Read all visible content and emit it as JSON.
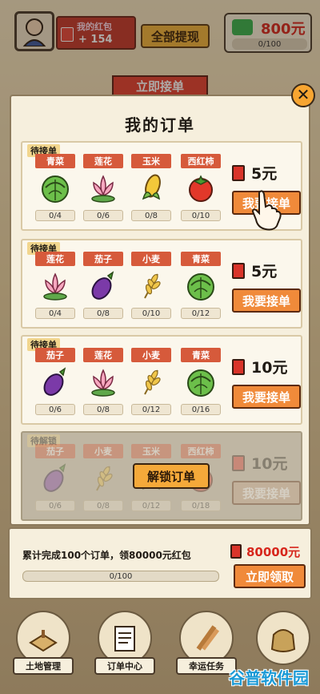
{
  "header": {
    "wallet_label": "我的红包",
    "wallet_value": "+ 154",
    "withdraw_all": "全部提现",
    "cash_amount": "800元",
    "cash_progress": "0/100"
  },
  "background_button": "立即接单",
  "modal": {
    "title": "我的订单",
    "close": "✕",
    "orders": [
      {
        "tag": "待接单",
        "items": [
          {
            "name": "青菜",
            "icon": "cabbage-icon",
            "count": "0/4"
          },
          {
            "name": "莲花",
            "icon": "lotus-icon",
            "count": "0/6"
          },
          {
            "name": "玉米",
            "icon": "corn-icon",
            "count": "0/8"
          },
          {
            "name": "西红柿",
            "icon": "tomato-icon",
            "count": "0/10"
          }
        ],
        "reward": "5元",
        "action": "我要接单"
      },
      {
        "tag": "待接单",
        "items": [
          {
            "name": "莲花",
            "icon": "lotus-icon",
            "count": "0/4"
          },
          {
            "name": "茄子",
            "icon": "eggplant-icon",
            "count": "0/8"
          },
          {
            "name": "小麦",
            "icon": "wheat-icon",
            "count": "0/10"
          },
          {
            "name": "青菜",
            "icon": "cabbage-icon",
            "count": "0/12"
          }
        ],
        "reward": "5元",
        "action": "我要接单"
      },
      {
        "tag": "待接单",
        "items": [
          {
            "name": "茄子",
            "icon": "eggplant-icon",
            "count": "0/6"
          },
          {
            "name": "莲花",
            "icon": "lotus-icon",
            "count": "0/8"
          },
          {
            "name": "小麦",
            "icon": "wheat-icon",
            "count": "0/12"
          },
          {
            "name": "青菜",
            "icon": "cabbage-icon",
            "count": "0/16"
          }
        ],
        "reward": "10元",
        "action": "我要接单"
      },
      {
        "tag": "待解锁",
        "items": [
          {
            "name": "茄子",
            "icon": "eggplant-icon",
            "count": "0/6"
          },
          {
            "name": "小麦",
            "icon": "wheat-icon",
            "count": "0/8"
          },
          {
            "name": "玉米",
            "icon": "corn-icon",
            "count": "0/12"
          },
          {
            "name": "西红柿",
            "icon": "tomato-icon",
            "count": "0/18"
          }
        ],
        "reward": "10元",
        "action": "我要接单",
        "unlock": "解锁订单"
      }
    ]
  },
  "cumulative": {
    "description": "累计完成100个订单，领80000元红包",
    "progress": "0/100",
    "reward": "80000元",
    "claim": "立即领取"
  },
  "nav": [
    {
      "label": "土地管理",
      "icon": "land-icon"
    },
    {
      "label": "订单中心",
      "icon": "order-center-icon"
    },
    {
      "label": "幸运任务",
      "icon": "lucky-task-icon"
    },
    {
      "label": "",
      "icon": "bag-icon"
    }
  ],
  "watermark": "谷普软件园"
}
